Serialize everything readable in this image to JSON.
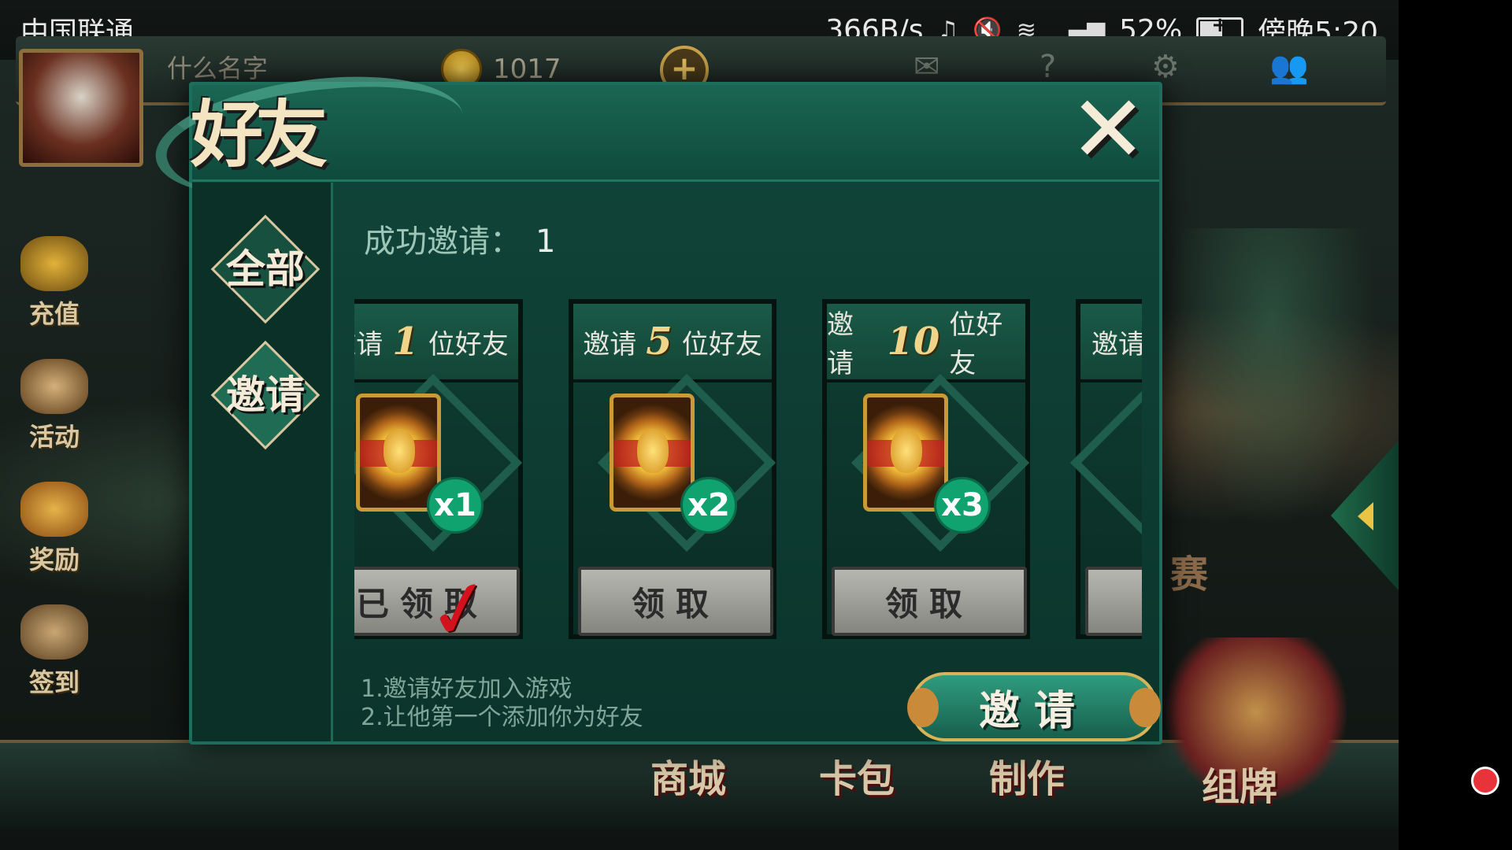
{
  "status_bar": {
    "carrier": "中国联通",
    "net_speed": "366B/s",
    "battery": "52%",
    "time": "傍晚5:20",
    "icons": [
      "headphones-icon",
      "mute-icon",
      "wifi-icon",
      "signal-4g-icon",
      "battery-icon"
    ],
    "battery_level": 0.52
  },
  "hud": {
    "player_name": "什么名字",
    "coins": "1017",
    "add_label": "+"
  },
  "side_menu": [
    {
      "label": "充值",
      "icon": "coins-icon"
    },
    {
      "label": "活动",
      "icon": "scroll-icon"
    },
    {
      "label": "奖励",
      "icon": "chest-icon"
    },
    {
      "label": "签到",
      "icon": "scroll-map-icon"
    }
  ],
  "bottom_nav": [
    {
      "label": "商城"
    },
    {
      "label": "卡包"
    },
    {
      "label": "制作"
    },
    {
      "label": "组牌"
    }
  ],
  "background_text": {
    "race_char": "赛"
  },
  "dialog": {
    "title": "好友",
    "close_label": "✕",
    "tabs": [
      {
        "label": "全部",
        "active": false
      },
      {
        "label": "邀请",
        "active": true
      }
    ],
    "invite_label": "成功邀请：",
    "invite_count": "1",
    "rewards": [
      {
        "prefix": "邀请",
        "number": "1",
        "suffix": "位好友",
        "quantity": "x1",
        "button": "已领取",
        "claimed": true
      },
      {
        "prefix": "邀请",
        "number": "5",
        "suffix": "位好友",
        "quantity": "x2",
        "button": "领取",
        "claimed": false
      },
      {
        "prefix": "邀请",
        "number": "10",
        "suffix": "位好友",
        "quantity": "x3",
        "button": "领取",
        "claimed": false
      },
      {
        "prefix": "邀请",
        "number": "",
        "suffix": "",
        "quantity": "",
        "button": "",
        "claimed": false
      }
    ],
    "instructions": [
      "1.邀请好友加入游戏",
      "2.让他第一个添加你为好友"
    ],
    "invite_button": "邀请"
  },
  "colors": {
    "dialog_bg": "#0b342b",
    "accent_green": "#10a26f",
    "claimed_check": "#d4121e",
    "gold": "#f0d48a"
  }
}
